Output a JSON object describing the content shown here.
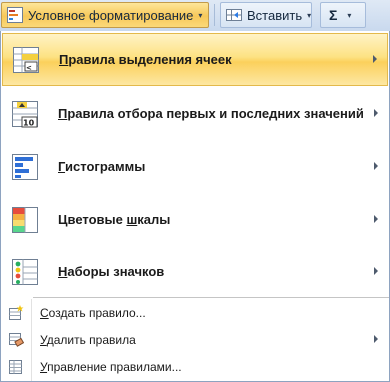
{
  "ribbon": {
    "cond_format": {
      "label": "Условное форматирование",
      "icon": "conditional-formatting-icon"
    },
    "insert": {
      "label": "Вставить",
      "icon": "insert-cells-icon"
    },
    "sum": {
      "symbol": "Σ",
      "icon": "autosum-icon"
    }
  },
  "menu": {
    "primary_items": [
      {
        "key": "П",
        "rest": "равила выделения ячеек",
        "icon": "highlight-cells-rules-icon",
        "has_submenu": true,
        "highlighted": true
      },
      {
        "key": "П",
        "rest": "равила отбора первых и последних значений",
        "icon": "top-bottom-rules-icon",
        "has_submenu": true
      },
      {
        "key": "Г",
        "rest": "истограммы",
        "icon": "data-bars-icon",
        "has_submenu": true
      },
      {
        "pre": "Цветовые ",
        "key": "ш",
        "rest": "калы",
        "icon": "color-scales-icon",
        "has_submenu": true
      },
      {
        "key": "Н",
        "rest": "аборы значков",
        "icon": "icon-sets-icon",
        "has_submenu": true
      }
    ],
    "secondary_items": [
      {
        "key": "С",
        "rest": "оздать правило...",
        "icon": "new-rule-icon",
        "has_submenu": false
      },
      {
        "key": "У",
        "rest": "далить правила",
        "icon": "clear-rules-icon",
        "has_submenu": true
      },
      {
        "key": "У",
        "rest": "правление правилами...",
        "icon": "manage-rules-icon",
        "has_submenu": false
      }
    ]
  },
  "colors": {
    "highlight": "#fde283",
    "ribbon": "#d4e1f2",
    "menu_border": "#8ea3c0"
  }
}
